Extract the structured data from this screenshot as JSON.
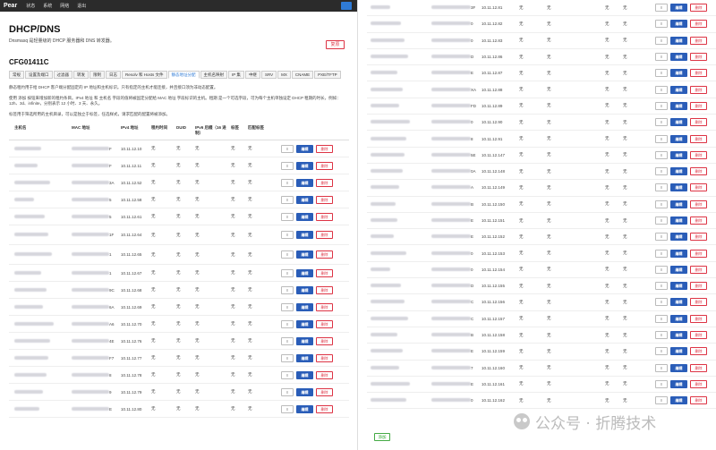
{
  "topbar": {
    "brand": "Pear",
    "menu": [
      "状态",
      "系统",
      "网络",
      "退出"
    ]
  },
  "page": {
    "title": "DHCP/DNS",
    "description": "Dnsmasq 是轻量级的 DHCP 服务器和 DNS 转发器。",
    "reset_label": "复原",
    "section": "CFG01411C"
  },
  "tabs": [
    "常规",
    "设置及端口",
    "过滤器",
    "转发",
    "限制",
    "日志",
    "Resolv 和 Hosts 文件",
    "静态地址分配",
    "主机名映射",
    "IP 集",
    "中继",
    "SRV",
    "MX",
    "CNAME",
    "PXE/TFTP"
  ],
  "active_tab": "静态地址分配",
  "paras": [
    "静态租约用于给 DHCP 客户端分配固定的 IP 地址和主机标识。只有指定的主机才能连接，并且接口须为非动态配置。",
    "使用 添加 按钮来增加新的租约条目。IPv4 地址 和 主机名 字段的值将被固定分配给 MAC 地址 字段标识的主机。租期 是一个可选字段，可为每个主机单独设定 DHCP 租期的时长，例如：12h、3d、infinite，分别表示 12 小时、3 天、永久。",
    "标签用于筛选所用的主机目录，可以是独立于标签，任选样式，请求匹配的配置将被添加。"
  ],
  "headers": {
    "name": "主机名",
    "mac": "MAC 地址",
    "ipv4": "IPv4 地址",
    "lease": "租约时间",
    "duid": "DUID",
    "ipv6": "IPv6 后缀（16 进制）",
    "tag": "标签",
    "match": "匹配标签"
  },
  "actions": {
    "more": "≡",
    "edit": "编辑",
    "delete": "删除",
    "add": "添加"
  },
  "none": "无",
  "left_rows": [
    {
      "mac": "F",
      "ip": "10.11.12.10"
    },
    {
      "mac": "F",
      "ip": "10.11.12.11"
    },
    {
      "mac": "3A",
      "ip": "10.11.12.52"
    },
    {
      "mac": "5",
      "ip": "10.11.12.58"
    },
    {
      "mac": "5",
      "ip": "10.11.12.61"
    },
    {
      "mac": "1F",
      "ip": "10.11.12.64"
    },
    {
      "mac": "1",
      "ip": "10.11.12.65"
    },
    {
      "mac": "1",
      "ip": "10.11.12.67"
    },
    {
      "mac": "9C",
      "ip": "10.11.12.68"
    },
    {
      "mac": "6A",
      "ip": "10.11.12.69"
    },
    {
      "mac": "A6",
      "ip": "10.11.12.70"
    },
    {
      "mac": "4E",
      "ip": "10.11.12.76"
    },
    {
      "mac": "F7",
      "ip": "10.11.12.77"
    },
    {
      "mac": "8",
      "ip": "10.11.12.78"
    },
    {
      "mac": "9",
      "ip": "10.11.12.79"
    },
    {
      "mac": "E",
      "ip": "10.11.12.80"
    }
  ],
  "right_rows": [
    {
      "mac": "3F",
      "ip": "10.11.12.81"
    },
    {
      "mac": "0",
      "ip": "10.11.12.82"
    },
    {
      "mac": "0",
      "ip": "10.11.12.83"
    },
    {
      "mac": "D",
      "ip": "10.11.12.86"
    },
    {
      "mac": "E",
      "ip": "10.11.12.87"
    },
    {
      "mac": "XA",
      "ip": "10.11.12.88"
    },
    {
      "mac": "FD",
      "ip": "10.11.12.89"
    },
    {
      "mac": "0",
      "ip": "10.11.12.90"
    },
    {
      "mac": "8",
      "ip": "10.11.12.91"
    },
    {
      "mac": "5E",
      "ip": "10.11.12.147"
    },
    {
      "mac": "0A",
      "ip": "10.11.12.148"
    },
    {
      "mac": "A",
      "ip": "10.11.12.149"
    },
    {
      "mac": "B",
      "ip": "10.11.12.150"
    },
    {
      "mac": "E",
      "ip": "10.11.12.151"
    },
    {
      "mac": "E",
      "ip": "10.11.12.152"
    },
    {
      "mac": "0",
      "ip": "10.11.12.153"
    },
    {
      "mac": "0",
      "ip": "10.11.12.154"
    },
    {
      "mac": "D",
      "ip": "10.11.12.155"
    },
    {
      "mac": "C",
      "ip": "10.11.12.156"
    },
    {
      "mac": "C",
      "ip": "10.11.12.157"
    },
    {
      "mac": "B",
      "ip": "10.11.12.158"
    },
    {
      "mac": "E",
      "ip": "10.11.12.159"
    },
    {
      "mac": "7",
      "ip": "10.11.12.160"
    },
    {
      "mac": "E",
      "ip": "10.11.12.161"
    },
    {
      "mac": "0",
      "ip": "10.11.12.162"
    }
  ],
  "watermark": "公众号 · 折腾技术",
  "colors": {
    "topbar": "#2b2b2b",
    "edit": "#2a5db8",
    "delete": "#dd3344",
    "add": "#33aa33"
  }
}
